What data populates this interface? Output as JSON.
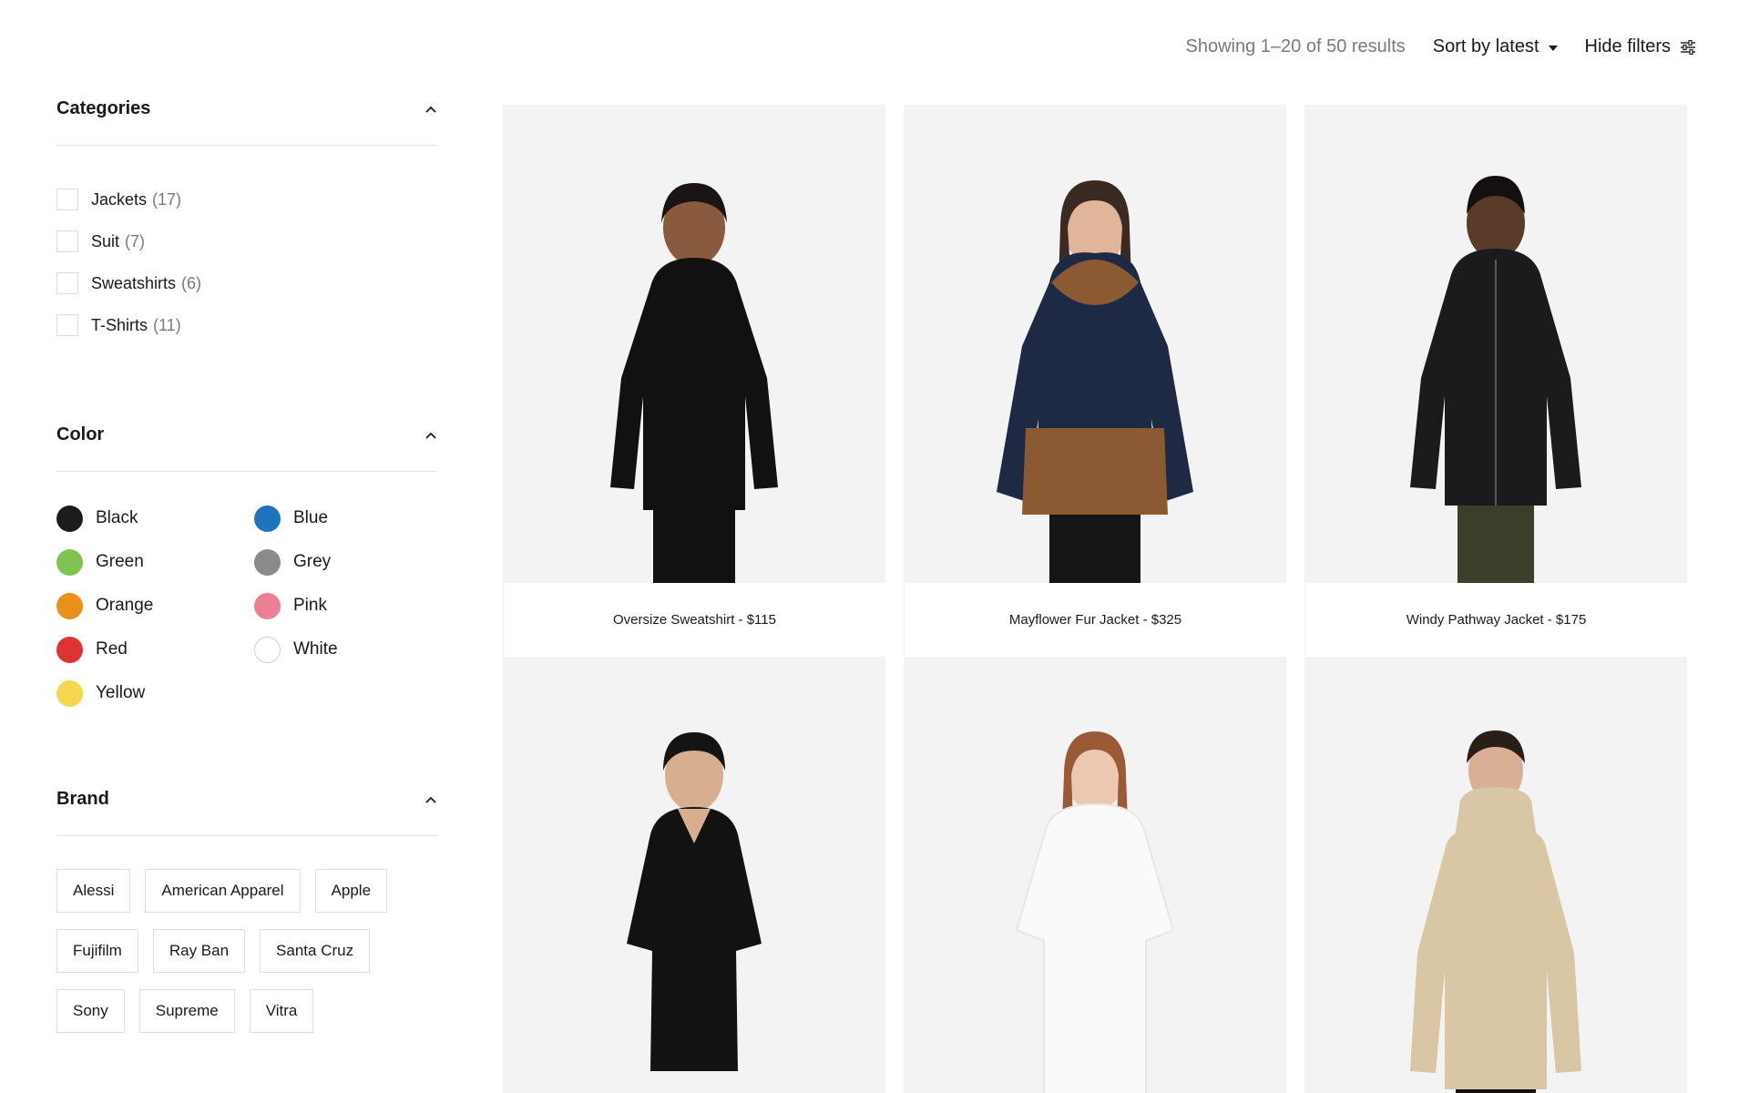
{
  "toolbar": {
    "results": "Showing 1–20 of 50 results",
    "sort_label": "Sort by latest",
    "hide_filters_label": "Hide filters"
  },
  "filters": {
    "categories": {
      "title": "Categories",
      "items": [
        {
          "label": "Jackets",
          "count": "(17)"
        },
        {
          "label": "Suit",
          "count": "(7)"
        },
        {
          "label": "Sweatshirts",
          "count": "(6)"
        },
        {
          "label": "T-Shirts",
          "count": "(11)"
        }
      ]
    },
    "color": {
      "title": "Color",
      "items": [
        {
          "label": "Black",
          "hex": "#1c1c1c"
        },
        {
          "label": "Blue",
          "hex": "#1e73be"
        },
        {
          "label": "Green",
          "hex": "#81c350"
        },
        {
          "label": "Grey",
          "hex": "#8a8a8a"
        },
        {
          "label": "Orange",
          "hex": "#e8901a"
        },
        {
          "label": "Pink",
          "hex": "#ec7e95"
        },
        {
          "label": "Red",
          "hex": "#dd3333"
        },
        {
          "label": "White",
          "hex": "#ffffff"
        },
        {
          "label": "Yellow",
          "hex": "#f7d54f"
        }
      ]
    },
    "brand": {
      "title": "Brand",
      "items": [
        "Alessi",
        "American Apparel",
        "Apple",
        "Fujifilm",
        "Ray Ban",
        "Santa Cruz",
        "Sony",
        "Supreme",
        "Vitra"
      ]
    }
  },
  "products": [
    {
      "name": "Oversize Sweatshirt - $115",
      "garment_color": "#111111"
    },
    {
      "name": "Mayflower Fur Jacket - $325",
      "garment_color": "#1e2a44"
    },
    {
      "name": "Windy Pathway Jacket - $175",
      "garment_color": "#1b1b1d"
    },
    {
      "name": "",
      "garment_color": "#121212"
    },
    {
      "name": "",
      "garment_color": "#fafafa"
    },
    {
      "name": "",
      "garment_color": "#d8c6a4"
    }
  ]
}
